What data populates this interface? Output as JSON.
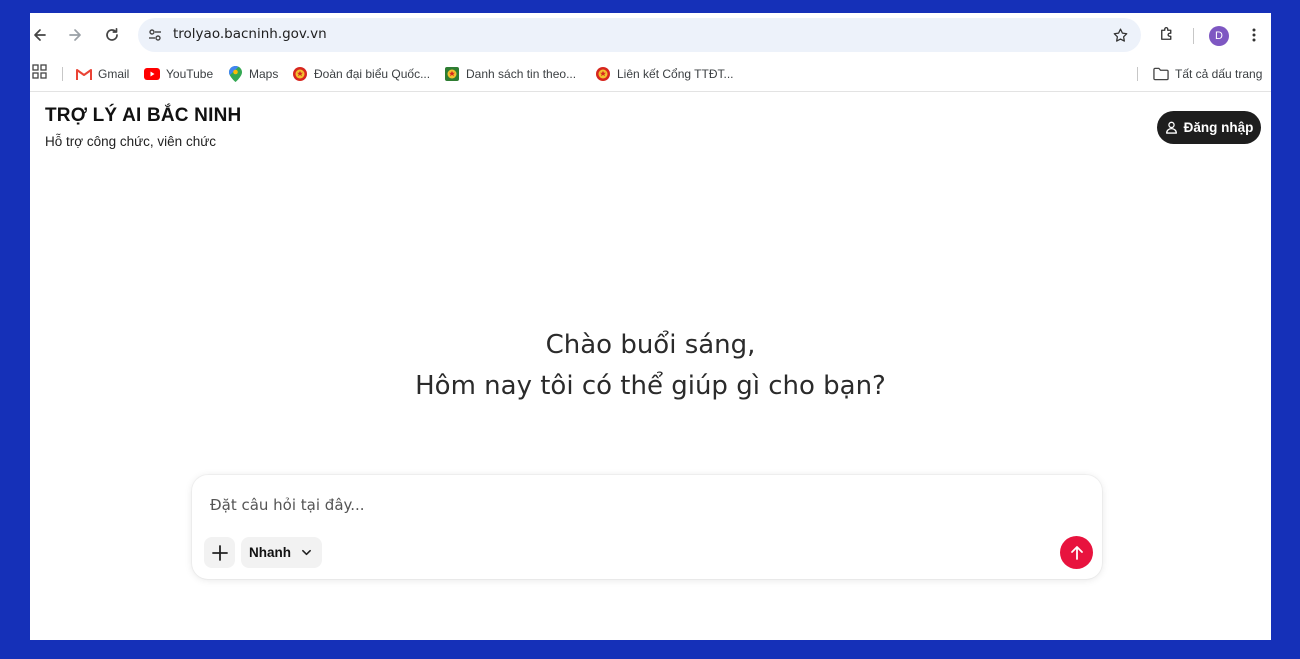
{
  "browser": {
    "url": "trolyao.bacninh.gov.vn",
    "avatar_letter": "D",
    "bookmarks": [
      {
        "label": "Gmail",
        "icon": "gmail-icon"
      },
      {
        "label": "YouTube",
        "icon": "youtube-icon"
      },
      {
        "label": "Maps",
        "icon": "maps-icon"
      },
      {
        "label": "Đoàn đại biểu Quốc...",
        "icon": "emblem-icon"
      },
      {
        "label": "Danh sách tin theo...",
        "icon": "emblem-icon"
      },
      {
        "label": "Liên kết Cổng TTĐT...",
        "icon": "emblem-icon"
      }
    ],
    "all_bookmarks_label": "Tất cả dấu trang"
  },
  "site": {
    "title": "TRỢ LÝ AI BẮC NINH",
    "subtitle": "Hỗ trợ công chức, viên chức",
    "login_label": "Đăng nhập"
  },
  "greeting": {
    "line1": "Chào buổi sáng,",
    "line2": "Hôm nay tôi có thể giúp gì cho bạn?"
  },
  "composer": {
    "placeholder": "Đặt câu hỏi tại đây...",
    "mode": "Nhanh"
  },
  "colors": {
    "frame_bg": "#1530b8",
    "send_button": "#e8133e",
    "login_button": "#1e1e1e",
    "avatar": "#7e57c2"
  }
}
